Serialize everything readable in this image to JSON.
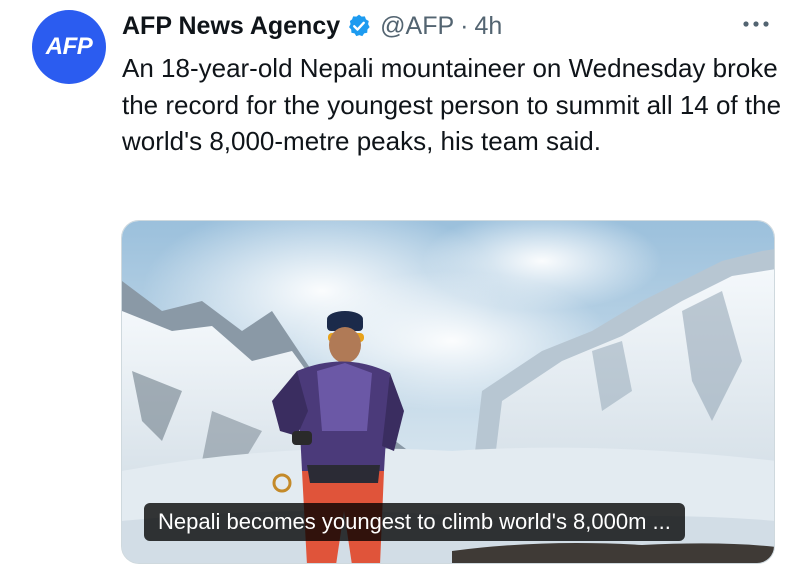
{
  "author": {
    "avatar_text": "AFP",
    "display_name": "AFP News Agency",
    "handle": "@AFP",
    "separator": "·",
    "time": "4h",
    "verified": true,
    "verified_icon": "verified-badge-icon"
  },
  "tweet": {
    "text": "An 18-year-old Nepali mountaineer on Wednesday broke the record for the youngest person to summit all 14 of the world's 8,000-metre peaks, his team said."
  },
  "card": {
    "caption": "Nepali becomes youngest to climb world's 8,000m ..."
  },
  "menu": {
    "icon": "more-options-icon"
  },
  "colors": {
    "brand_blue": "#2b5cf0",
    "verified_blue": "#1d9bf0",
    "secondary_text": "#536471"
  }
}
